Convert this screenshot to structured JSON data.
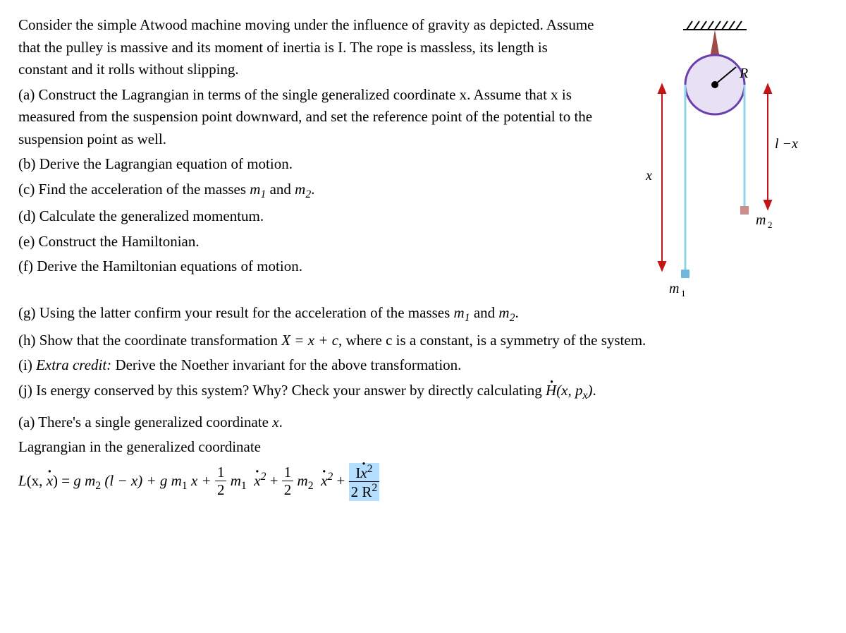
{
  "problem": {
    "intro": "Consider the simple Atwood machine moving under the influence of gravity as depicted.  Assume that the pulley is massive and its moment of inertia is I.  The rope is massless, its length is constant and it rolls without slipping.",
    "a": "(a) Construct the Lagrangian in terms of the single generalized coordinate x.  Assume that x is measured from the suspension point downward, and set the reference point of the potential to the suspension point as well.",
    "b": "(b) Derive the Lagrangian equation of motion.",
    "c_pre": "(c) Find the acceleration of the masses ",
    "c_m1": "m",
    "c_and": " and ",
    "c_m2": "m",
    "c_post": ".",
    "d": "(d) Calculate the generalized momentum.",
    "e": "(e) Construct the Hamiltonian.",
    "f": "(f) Derive the Hamiltonian equations of motion.",
    "g_pre": "(g) Using the latter confirm your result for the acceleration of the masses ",
    "g_m1": "m",
    "g_and": " and ",
    "g_m2": "m",
    "g_post": ".",
    "h_pre": "(h) Show that the coordinate transformation ",
    "h_eq": "X = x + c",
    "h_post": ", where c is a constant, is a symmetry of the system.",
    "i_pre": "(i) ",
    "i_emph": "Extra credit:",
    "i_post": " Derive the Noether invariant for the above transformation.",
    "j_pre": "(j) Is energy conserved by this system?  Why?  Check your answer by directly calculating ",
    "j_post": "."
  },
  "solution": {
    "a1": "(a) There's a single generalized coordinate x.",
    "a2": "Lagrangian in the generalized coordinate"
  },
  "eq": {
    "lhs1": "L",
    "lhs2": "(x, ",
    "lhs3": ") = ",
    "t1a": "g m",
    "t1b": " (l − x) + g m",
    "t1c": " x + ",
    "half_num": "1",
    "half_den": "2",
    "t2a": " m",
    "t2c": " + ",
    "t3a": " m",
    "t3c": " + ",
    "t4num_a": "I",
    "t4den_a": "2 R",
    "sup2": "2"
  },
  "fig": {
    "R": "R",
    "x": "x",
    "lmx": "l −x",
    "m1": "m",
    "m2": "m",
    "sub1": "1",
    "sub2": "2"
  }
}
